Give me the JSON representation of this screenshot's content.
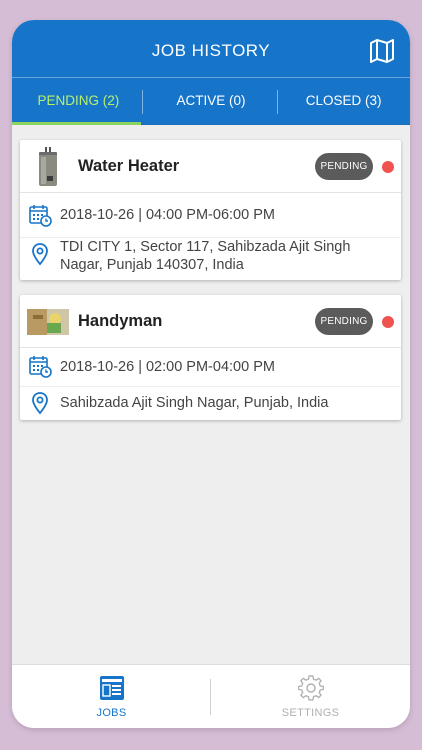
{
  "header": {
    "title": "JOB HISTORY",
    "map_icon": "map-icon"
  },
  "tabs": [
    {
      "label": "PENDING (2)",
      "active": true
    },
    {
      "label": "ACTIVE (0)",
      "active": false
    },
    {
      "label": "CLOSED (3)",
      "active": false
    }
  ],
  "jobs": [
    {
      "service": "Water Heater",
      "status": "PENDING",
      "datetime": "2018-10-26 | 04:00 PM-06:00 PM",
      "address": "TDI CITY 1, Sector 117, Sahibzada Ajit Singh Nagar, Punjab 140307, India",
      "thumb": "water-heater-image"
    },
    {
      "service": "Handyman",
      "status": "PENDING",
      "datetime": "2018-10-26 | 02:00 PM-04:00 PM",
      "address": "Sahibzada Ajit Singh Nagar, Punjab, India",
      "thumb": "handyman-image"
    }
  ],
  "bottom_nav": [
    {
      "label": "JOBS",
      "icon": "jobs-icon",
      "active": true
    },
    {
      "label": "SETTINGS",
      "icon": "gear-icon",
      "active": false
    }
  ],
  "colors": {
    "header": "#1775c9",
    "active_tab": "#b8f06b",
    "status_dot": "#ef5350",
    "badge": "#5b5b5b",
    "nav_active": "#1775c9",
    "nav_inactive": "#b0b0b0",
    "background": "#d5bdd6"
  }
}
